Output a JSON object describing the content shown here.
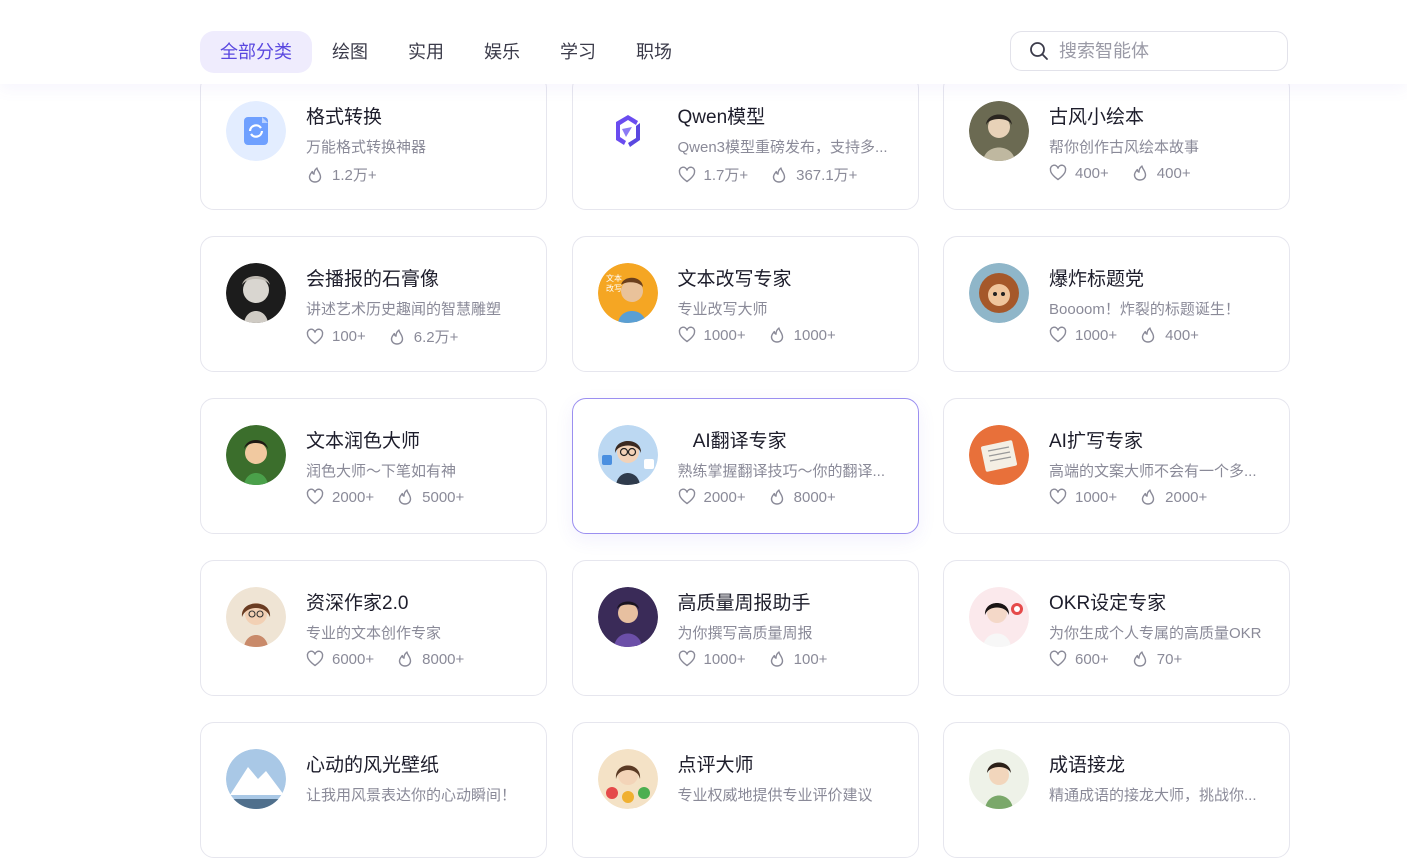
{
  "nav": {
    "tabs": [
      {
        "label": "全部分类",
        "active": true
      },
      {
        "label": "绘图",
        "active": false
      },
      {
        "label": "实用",
        "active": false
      },
      {
        "label": "娱乐",
        "active": false
      },
      {
        "label": "学习",
        "active": false
      },
      {
        "label": "职场",
        "active": false
      }
    ],
    "search_placeholder": "搜索智能体"
  },
  "cards": [
    {
      "title": "格式转换",
      "desc": "万能格式转换神器",
      "likes": null,
      "uses": "1.2万+",
      "avatar": "format-convert-icon"
    },
    {
      "title": "Qwen模型",
      "desc": "Qwen3模型重磅发布，支持多...",
      "likes": "1.7万+",
      "uses": "367.1万+",
      "avatar": "qwen-logo-icon"
    },
    {
      "title": "古风小绘本",
      "desc": "帮你创作古风绘本故事",
      "likes": "400+",
      "uses": "400+",
      "avatar": "ancient-style-avatar"
    },
    {
      "title": "会播报的石膏像",
      "desc": "讲述艺术历史趣闻的智慧雕塑",
      "likes": "100+",
      "uses": "6.2万+",
      "avatar": "plaster-statue-avatar"
    },
    {
      "title": "文本改写专家",
      "desc": "专业改写大师",
      "likes": "1000+",
      "uses": "1000+",
      "avatar": "rewrite-expert-avatar"
    },
    {
      "title": "爆炸标题党",
      "desc": "Boooom！炸裂的标题诞生！",
      "likes": "1000+",
      "uses": "400+",
      "avatar": "explosive-title-avatar"
    },
    {
      "title": "文本润色大师",
      "desc": "润色大师～下笔如有神",
      "likes": "2000+",
      "uses": "5000+",
      "avatar": "polish-master-avatar"
    },
    {
      "title": "AI翻译专家",
      "desc": "熟练掌握翻译技巧～你的翻译...",
      "likes": "2000+",
      "uses": "8000+",
      "avatar": "translator-avatar",
      "highlight": true
    },
    {
      "title": "AI扩写专家",
      "desc": "高端的文案大师不会有一个多...",
      "likes": "1000+",
      "uses": "2000+",
      "avatar": "expand-writer-avatar"
    },
    {
      "title": "资深作家2.0",
      "desc": "专业的文本创作专家",
      "likes": "6000+",
      "uses": "8000+",
      "avatar": "senior-writer-avatar"
    },
    {
      "title": "高质量周报助手",
      "desc": "为你撰写高质量周报",
      "likes": "1000+",
      "uses": "100+",
      "avatar": "weekly-report-avatar"
    },
    {
      "title": "OKR设定专家",
      "desc": "为你生成个人专属的高质量OKR",
      "likes": "600+",
      "uses": "70+",
      "avatar": "okr-expert-avatar"
    },
    {
      "title": "心动的风光壁纸",
      "desc": "让我用风景表达你的心动瞬间！",
      "likes": null,
      "uses": null,
      "avatar": "landscape-wallpaper-avatar"
    },
    {
      "title": "点评大师",
      "desc": "专业权威地提供专业评价建议",
      "likes": null,
      "uses": null,
      "avatar": "review-master-avatar"
    },
    {
      "title": "成语接龙",
      "desc": "精通成语的接龙大师，挑战你...",
      "likes": null,
      "uses": null,
      "avatar": "idiom-chain-avatar"
    }
  ],
  "colors": {
    "accent": "#5a48e0",
    "accent_bg": "#efecfd",
    "muted": "#8a8a98"
  }
}
